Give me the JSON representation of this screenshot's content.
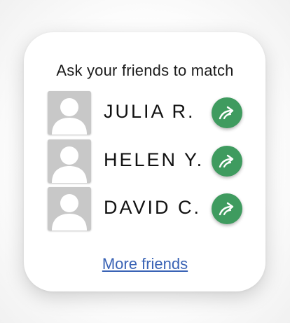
{
  "card": {
    "title": "Ask your friends to match",
    "friends": [
      {
        "name": "JULIA R.",
        "avatar_icon": "person-placeholder-icon",
        "action_icon": "share-arrow-icon"
      },
      {
        "name": "HELEN Y.",
        "avatar_icon": "person-placeholder-icon",
        "action_icon": "share-arrow-icon"
      },
      {
        "name": "DAVID C.",
        "avatar_icon": "person-placeholder-icon",
        "action_icon": "share-arrow-icon"
      }
    ],
    "more_link": "More friends"
  },
  "colors": {
    "share_button": "#3f9b5f",
    "link": "#3a63b5",
    "avatar_bg": "#c8c8c8"
  }
}
